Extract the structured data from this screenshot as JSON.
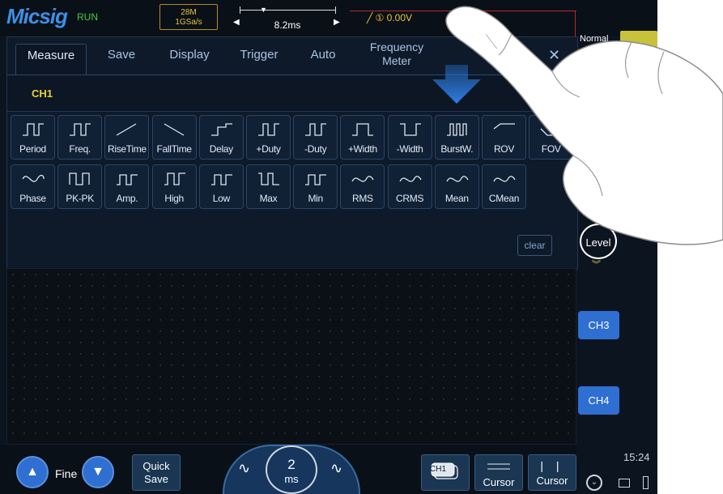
{
  "header": {
    "brand": "Micsig",
    "run_state": "RUN",
    "memory_depth": "28M",
    "sample_rate": "1GSa/s",
    "time_offset": "8.2ms",
    "trigger_level": "① 0.00V"
  },
  "tabs": [
    {
      "label": "Measure"
    },
    {
      "label": "Save"
    },
    {
      "label": "Display"
    },
    {
      "label": "Trigger"
    },
    {
      "label": "Auto"
    },
    {
      "label": "Frequency Meter"
    }
  ],
  "measure": {
    "channel": "CH1",
    "row1": [
      "Period",
      "Freq.",
      "RiseTime",
      "FallTime",
      "Delay",
      "+Duty",
      "-Duty",
      "+Width",
      "-Width",
      "BurstW.",
      "ROV",
      "FOV"
    ],
    "row2": [
      "Phase",
      "PK-PK",
      "Amp.",
      "High",
      "Low",
      "Max",
      "Min",
      "RMS",
      "CRMS",
      "Mean",
      "CMean"
    ],
    "clear_label": "clear"
  },
  "side": {
    "trigger_mode": "Normal",
    "level_label": "Level",
    "ch3": "CH3",
    "ch4": "CH4",
    "clock": "15:24"
  },
  "bottom": {
    "fine_label": "Fine",
    "quick_save_line1": "Quick",
    "quick_save_line2": "Save",
    "timebase_value": "2",
    "timebase_unit": "ms",
    "ch1_label": "CH1",
    "cursor1": "Cursor",
    "cursor2": "Cursor"
  },
  "colors": {
    "accent": "#2f6fd1",
    "channel1": "#e8d23a",
    "run": "#3fcf3f",
    "trigger_line": "#b72727"
  }
}
